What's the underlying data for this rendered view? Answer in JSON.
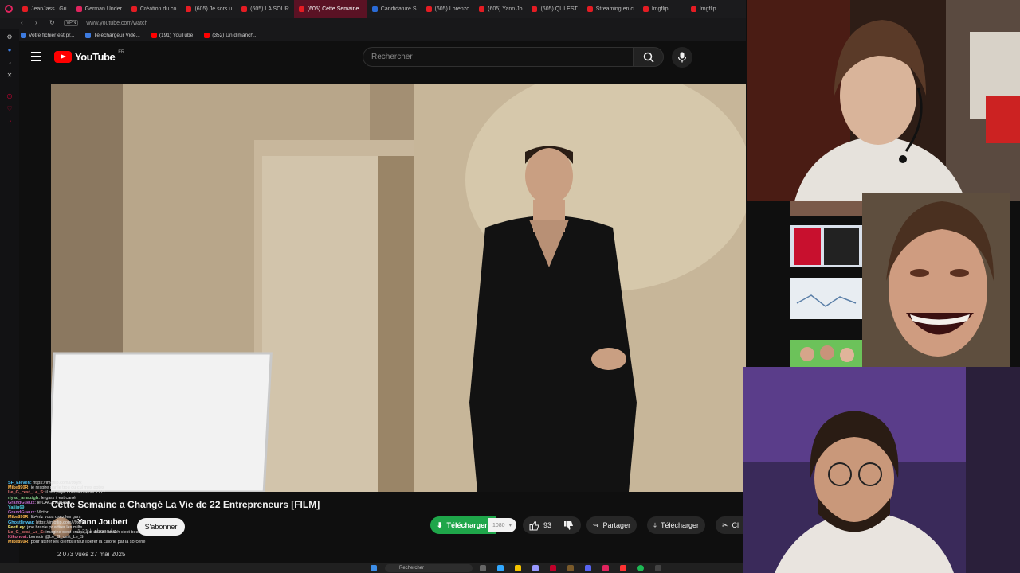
{
  "browser": {
    "tabs": [
      {
        "label": "JeanJass | Gri",
        "icon": "red"
      },
      {
        "label": "German Under",
        "icon": "pink"
      },
      {
        "label": "Création du co",
        "icon": "red"
      },
      {
        "label": "(605) Je sors u",
        "icon": "red"
      },
      {
        "label": "(605) LA SOUR",
        "icon": "red"
      },
      {
        "label": "(605) Cette Semaine",
        "icon": "red",
        "active": true
      },
      {
        "label": "Candidature S",
        "icon": "blue"
      },
      {
        "label": "(605) Lorenzo",
        "icon": "red"
      },
      {
        "label": "(605) Yann Jo",
        "icon": "red"
      },
      {
        "label": "(605) QUI EST",
        "icon": "red"
      },
      {
        "label": "Streaming en c",
        "icon": "red"
      },
      {
        "label": "Imgflip",
        "icon": "red"
      },
      {
        "label": "Imgflip",
        "icon": "red"
      }
    ],
    "address": "www.youtube.com/watch",
    "vpn": "VPN",
    "bookmarks": [
      {
        "label": "Votre fichier est pr...",
        "icon": "blue"
      },
      {
        "label": "Téléchargeur Vidé...",
        "icon": "blue"
      },
      {
        "label": "(191) YouTube",
        "icon": "red"
      },
      {
        "label": "(352) Un dimanch...",
        "icon": "red"
      }
    ]
  },
  "youtube": {
    "logo_text": "YouTube",
    "region": "FR",
    "search_placeholder": "Rechercher",
    "video": {
      "title": "Cette Semaine a Changé La Vie de 22 Entrepreneurs [FILM]",
      "date": "2 073 vues  27 mai 2025"
    },
    "channel": {
      "name": "Yann Joubert",
      "subscribers": "1,31 k abonnés",
      "subscribe_label": "S'abonner"
    },
    "actions": {
      "download_green": "Télécharger",
      "quality": "1080",
      "likes": "93",
      "share": "Partager",
      "download": "Télécharger",
      "clip": "Cl"
    }
  },
  "chat": [
    {
      "user": "SF_Eleven:",
      "msg": "https://imgflip.com/i/9xyfx",
      "color": "#4fc3f7"
    },
    {
      "user": "Mike890R:",
      "msg": "je respire par le trou du cul mes potes",
      "color": "#ffb74d"
    },
    {
      "user": "Le_G_cest_Le_S:",
      "msg": "il ont payé combien alors ????",
      "color": "#e57373"
    },
    {
      "user": "riyad_amazigh:",
      "msg": "le gars il est carré",
      "color": "#81c784"
    },
    {
      "user": "GrandGueux:",
      "msg": "le CACA HAHAH",
      "color": "#ba68c8"
    },
    {
      "user": "Yaijin69:",
      "msg": "",
      "color": "#4dd0e1"
    },
    {
      "user": "GrandGueux:",
      "msg": "Victor",
      "color": "#ba68c8"
    },
    {
      "user": "Mike890R:",
      "msg": "lib4nlz vous osez les gars",
      "color": "#ffb74d"
    },
    {
      "user": "Ghostlinwar:",
      "msg": "https://imgflip.com/i/9xyfxt",
      "color": "#4fc3f7"
    },
    {
      "user": "FeetLey:",
      "msg": "jme branle pr attirer les milfs",
      "color": "#fff176"
    },
    {
      "user": "Le_G_cest_Le_S:",
      "msg": "imagine c'est crame, j'ai décidé aaahh c'est beau",
      "color": "#e57373"
    },
    {
      "user": "Kikonost:",
      "msg": "bonsoir @Le_G_cest_Le_S",
      "color": "#f06292"
    },
    {
      "user": "Mike890R:",
      "msg": "pour attirer les clients il faut libérer la calorie par la sorcerie",
      "color": "#ffb74d"
    }
  ],
  "taskbar": {
    "search_label": "Rechercher"
  },
  "colors": {
    "brand_red": "#ff0000",
    "download_green": "#1fa64a",
    "active_tab": "#5a1224"
  }
}
